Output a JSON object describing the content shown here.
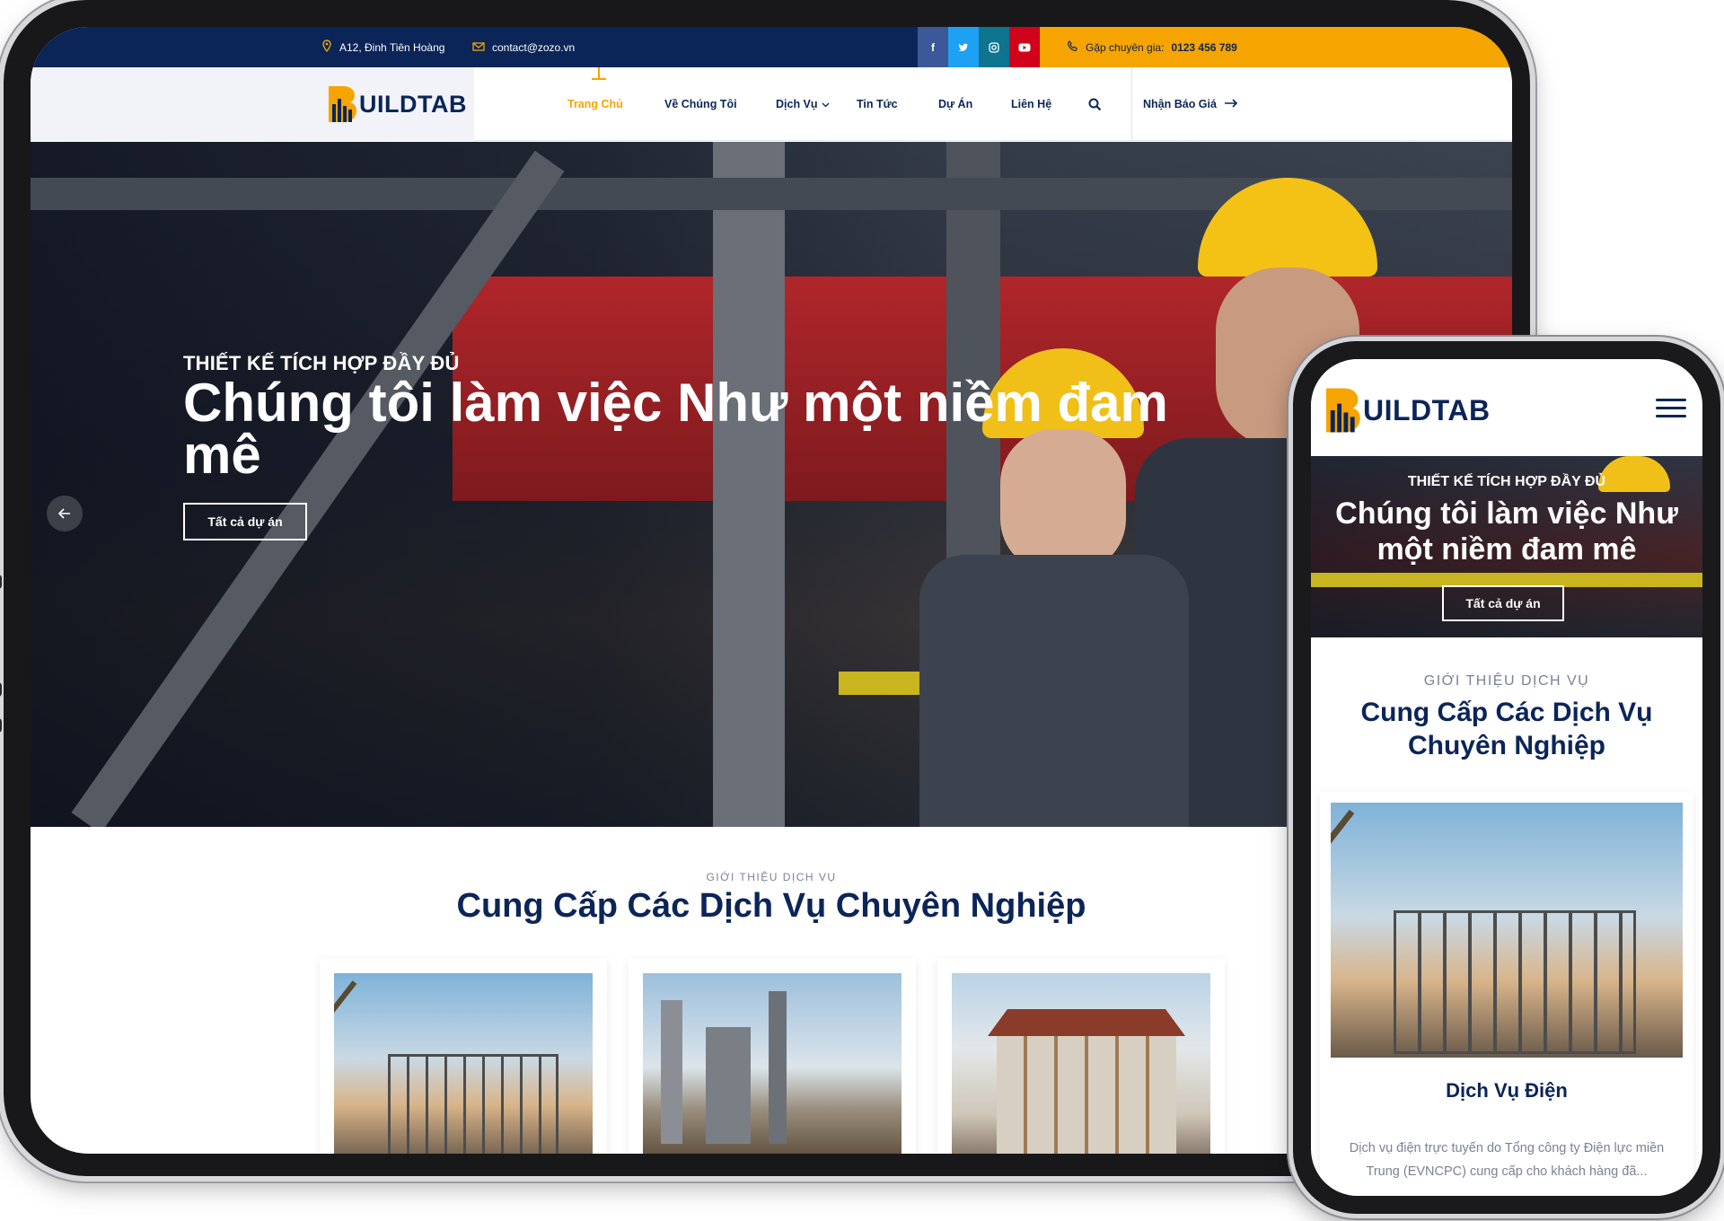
{
  "brand": {
    "logo_text": "UILDTAB",
    "colors": {
      "navy": "#0b2559",
      "accent": "#f6a400",
      "facebook": "#3b5998",
      "twitter": "#1da1f2",
      "instagram": "#0e7490",
      "youtube": "#d0021b"
    }
  },
  "topbar": {
    "address": "A12, Đinh Tiên Hoàng",
    "email": "contact@zozo.vn",
    "hotline_label": "Gặp chuyên gia:",
    "hotline_number": "0123 456 789",
    "socials": [
      "f",
      "t",
      "ig",
      "yt"
    ]
  },
  "nav": {
    "items": [
      {
        "label": "Trang Chủ",
        "active": true
      },
      {
        "label": "Về Chúng Tôi"
      },
      {
        "label": "Dịch Vụ",
        "dropdown": true
      },
      {
        "label": "Tin Tức"
      },
      {
        "label": "Dự Án"
      },
      {
        "label": "Liên Hệ"
      }
    ],
    "quote_label": "Nhận Báo Giá"
  },
  "hero": {
    "pretitle": "THIẾT KẾ TÍCH HỢP ĐẦY ĐỦ",
    "title": "Chúng tôi làm việc Như một niềm đam mê",
    "button": "Tất cả dự án"
  },
  "services": {
    "label": "GIỚI THIỆU DỊCH VỤ",
    "title": "Cung Cấp Các Dịch Vụ Chuyên Nghiệp"
  },
  "phone": {
    "hero_pretitle": "THIẾT KẾ TÍCH HỢP ĐẦY ĐỦ",
    "hero_title": "Chúng tôi làm việc Như một niềm đam mê",
    "hero_button": "Tất cả dự án",
    "services_label": "GIỚI THIỆU DỊCH VỤ",
    "services_title": "Cung Cấp Các Dịch Vụ Chuyên Nghiệp",
    "card_title": "Dịch Vụ Điện",
    "card_desc": "Dịch vụ điện trực tuyến do Tổng công ty Điện lực miền Trung (EVNCPC) cung cấp cho khách hàng đã..."
  }
}
